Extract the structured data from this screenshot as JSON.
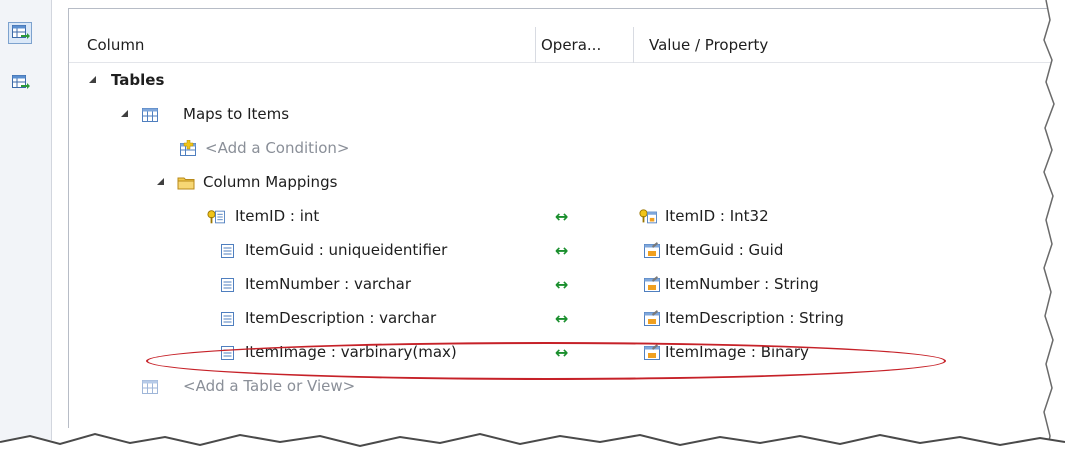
{
  "header": {
    "column": "Column",
    "operator": "Opera...",
    "value": "Value / Property"
  },
  "tree": {
    "tables_label": "Tables",
    "maps_label": "Maps to Items",
    "add_condition": "<Add a Condition>",
    "column_mappings_label": "Column Mappings",
    "add_table": "<Add a Table or View>"
  },
  "mappings": [
    {
      "column": "ItemID : int",
      "operator": "↔",
      "property": "ItemID : Int32",
      "key": true
    },
    {
      "column": "ItemGuid : uniqueidentifier",
      "operator": "↔",
      "property": "ItemGuid : Guid",
      "key": false
    },
    {
      "column": "ItemNumber : varchar",
      "operator": "↔",
      "property": "ItemNumber : String",
      "key": false
    },
    {
      "column": "ItemDescription : varchar",
      "operator": "↔",
      "property": "ItemDescription : String",
      "key": false
    },
    {
      "column": "ItemImage : varbinary(max)",
      "operator": "↔",
      "property": "ItemImage : Binary",
      "key": false
    }
  ],
  "toolbar": {
    "items": [
      {
        "icon": "map-table-icon",
        "active": true
      },
      {
        "icon": "map-function-icon",
        "active": false
      }
    ]
  },
  "colors": {
    "highlight": "#c62128",
    "arrow": "#1a8f2d",
    "muted_text": "#8a8f98"
  }
}
